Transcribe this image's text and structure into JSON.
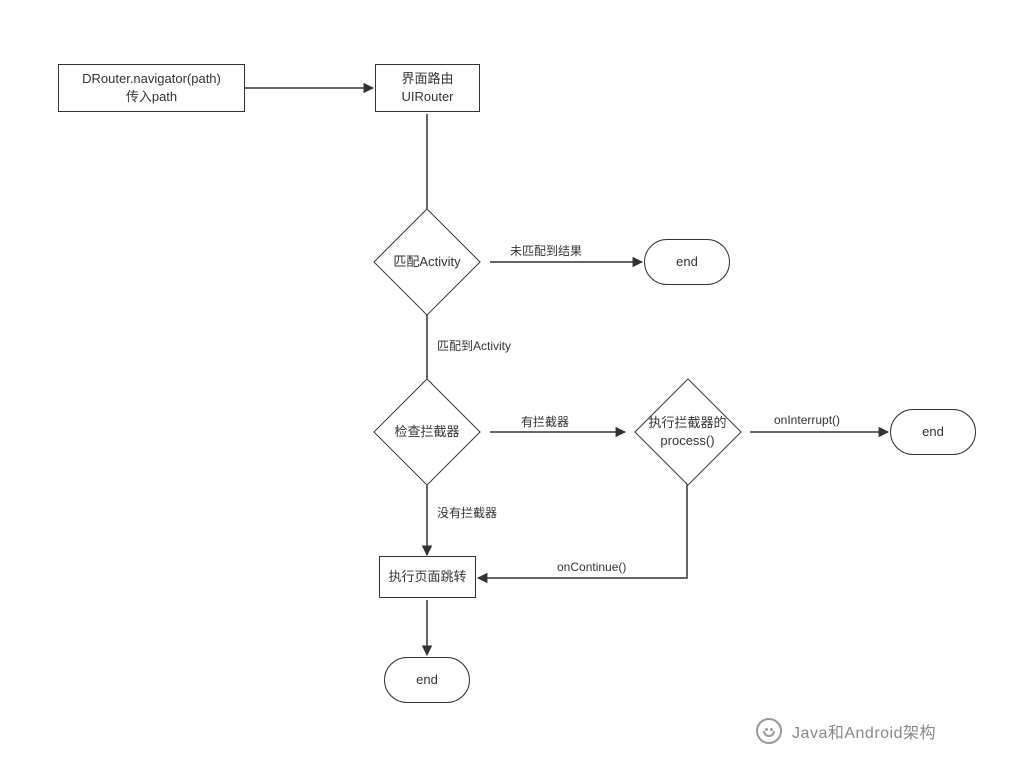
{
  "nodes": {
    "start": {
      "line1": "DRouter.navigator(path)",
      "line2": "传入path"
    },
    "uirouter": {
      "line1": "界面路由",
      "line2": "UIRouter"
    },
    "match_activity": "匹配Activity",
    "end1": "end",
    "check_interceptor": "检查拦截器",
    "exec_interceptor": {
      "line1": "执行拦截器的",
      "line2": "process()"
    },
    "end2": "end",
    "exec_page_jump": "执行页面跳转",
    "end3": "end"
  },
  "edges": {
    "no_match": "未匹配到结果",
    "matched": "匹配到Activity",
    "has_interceptor": "有拦截器",
    "no_interceptor": "没有拦截器",
    "on_interrupt": "onInterrupt()",
    "on_continue": "onContinue()"
  },
  "watermark": "Java和Android架构"
}
